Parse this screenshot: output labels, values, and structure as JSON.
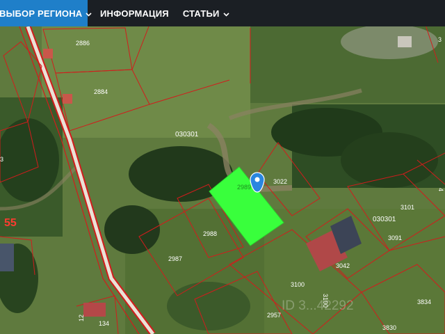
{
  "nav": {
    "region_label": "ВЫБОР РЕГИОНА",
    "info_label": "ИНФОРМАЦИЯ",
    "articles_label": "СТАТЬИ"
  },
  "map": {
    "quarter_labels": [
      "030301",
      "030301"
    ],
    "plot_numbers": {
      "p2886": "2886",
      "p2884": "2884",
      "p3022": "3022",
      "p2988": "2988",
      "p2987": "2987",
      "p3101": "3101",
      "p3091": "3091",
      "p3042": "3042",
      "p3100": "3100",
      "p3100v": "3100",
      "p2957": "2957",
      "p3830": "3830",
      "p3834": "3834",
      "p134": "134",
      "p3": "3",
      "p12": "12",
      "p4": "4",
      "p3r": "3"
    },
    "selected_plot_label": "2989",
    "large_label": "55",
    "watermark": "ID 3...42292",
    "colors": {
      "selected_plot": "#39ff3c",
      "boundary": "#d21c1c",
      "marker": "#2a86e0",
      "region_button": "#1f7fc9",
      "topbar": "#1b1f24"
    }
  }
}
